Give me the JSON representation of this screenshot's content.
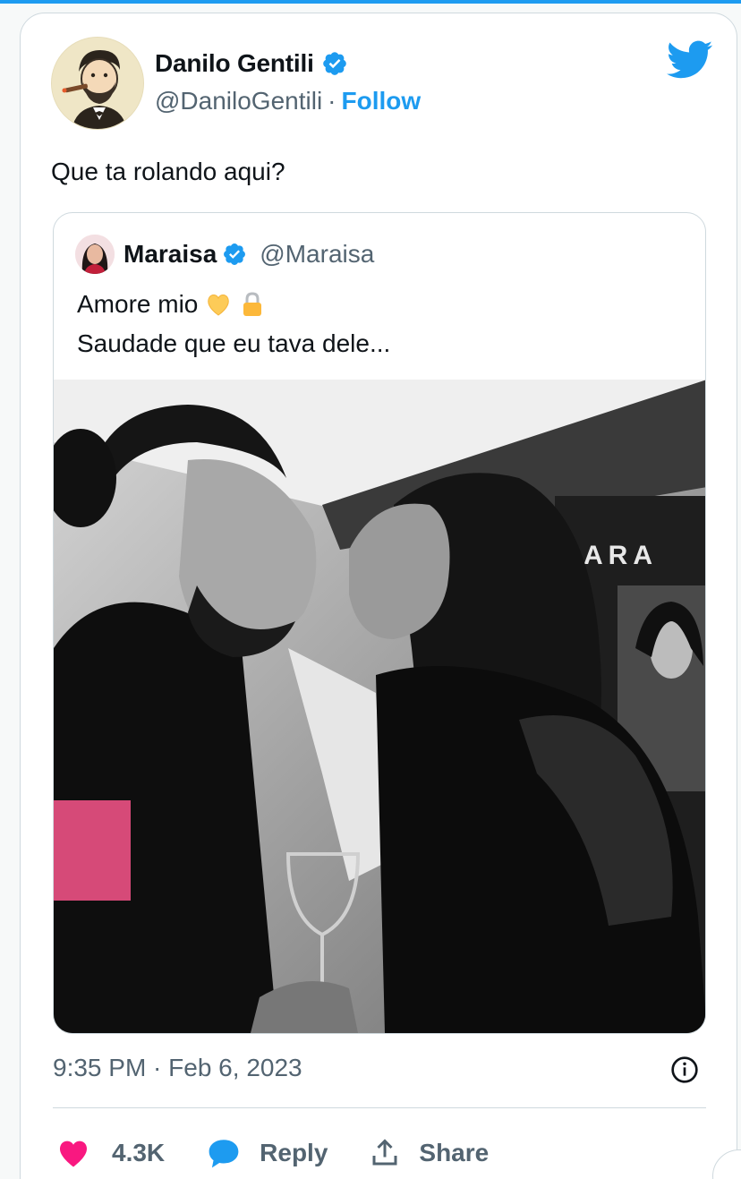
{
  "tweet": {
    "author": {
      "name": "Danilo Gentili",
      "handle": "@DaniloGentili",
      "verified": true,
      "avatar_icon": "caricature-avatar"
    },
    "separator": "·",
    "follow_label": "Follow",
    "brand_icon": "twitter-bird-icon",
    "text": "Que ta rolando aqui?",
    "timestamp": "9:35 PM · Feb 6, 2023",
    "info_icon": "info-icon",
    "actions": {
      "like_count": "4.3K",
      "reply_label": "Reply",
      "share_label": "Share"
    }
  },
  "quoted_tweet": {
    "author": {
      "name": "Maraisa",
      "handle": "@Maraisa",
      "verified": true
    },
    "lines": [
      "Amore mio",
      "Saudade que eu tava dele..."
    ],
    "emojis": [
      "yellow-heart",
      "lock"
    ],
    "photo": {
      "description_kind": "black-and-white-photo",
      "poster_text": "ARA"
    }
  },
  "colors": {
    "accent": "#1d9bf0",
    "text": "#0f1419",
    "muted": "#536471",
    "like": "#f91880",
    "border": "#cfd9de"
  }
}
